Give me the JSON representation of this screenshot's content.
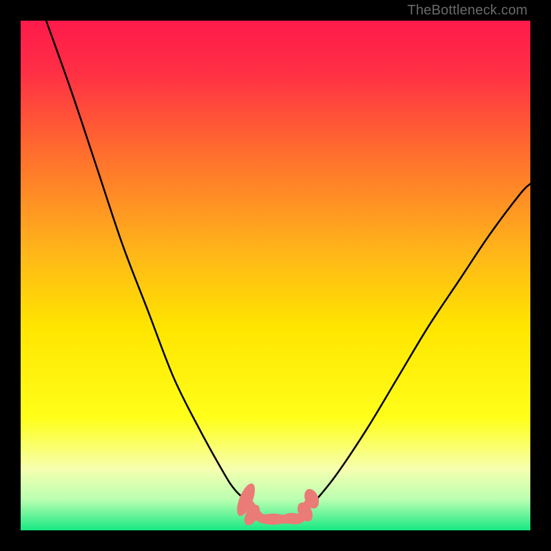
{
  "watermark": "TheBottleneck.com",
  "chart_data": {
    "type": "line",
    "title": "",
    "xlabel": "",
    "ylabel": "",
    "xlim": [
      0,
      100
    ],
    "ylim": [
      0,
      100
    ],
    "gradient_stops": [
      {
        "offset": 0.0,
        "color": "#ff1a4b"
      },
      {
        "offset": 0.1,
        "color": "#ff2f45"
      },
      {
        "offset": 0.25,
        "color": "#ff6a2f"
      },
      {
        "offset": 0.45,
        "color": "#ffb41a"
      },
      {
        "offset": 0.6,
        "color": "#ffe500"
      },
      {
        "offset": 0.78,
        "color": "#ffff1a"
      },
      {
        "offset": 0.88,
        "color": "#f6ffb0"
      },
      {
        "offset": 0.94,
        "color": "#b9ffb0"
      },
      {
        "offset": 1.0,
        "color": "#17e884"
      }
    ],
    "series": [
      {
        "name": "left-curve",
        "color": "#000000",
        "x": [
          5,
          10,
          15,
          20,
          25,
          30,
          35,
          40,
          42,
          44,
          46
        ],
        "y": [
          100,
          86,
          71,
          56,
          43,
          30,
          20,
          11,
          8,
          6,
          4
        ]
      },
      {
        "name": "right-curve",
        "color": "#000000",
        "x": [
          56,
          58,
          62,
          68,
          74,
          80,
          86,
          92,
          98,
          100
        ],
        "y": [
          4,
          6,
          11,
          20,
          30,
          40,
          49,
          58,
          66,
          68
        ]
      }
    ],
    "flat_segment": {
      "name": "valley-flat",
      "color": "#ea7b77",
      "x": [
        45,
        47,
        49,
        51,
        53,
        55,
        56,
        57
      ],
      "y": [
        5,
        2.5,
        2.2,
        2.2,
        2.2,
        2.5,
        4.5,
        6
      ]
    },
    "blobs": [
      {
        "cx": 44.2,
        "cy": 6.0,
        "rx": 1.3,
        "ry": 3.4,
        "rot": 22
      },
      {
        "cx": 45.4,
        "cy": 3.0,
        "rx": 1.2,
        "ry": 2.2,
        "rot": 30
      },
      {
        "cx": 49.5,
        "cy": 2.2,
        "rx": 2.8,
        "ry": 1.1,
        "rot": 0
      },
      {
        "cx": 53.5,
        "cy": 2.3,
        "rx": 2.2,
        "ry": 1.1,
        "rot": 5
      },
      {
        "cx": 55.8,
        "cy": 3.6,
        "rx": 1.3,
        "ry": 2.0,
        "rot": -28
      },
      {
        "cx": 57.1,
        "cy": 6.2,
        "rx": 1.3,
        "ry": 2.0,
        "rot": -22
      }
    ]
  }
}
